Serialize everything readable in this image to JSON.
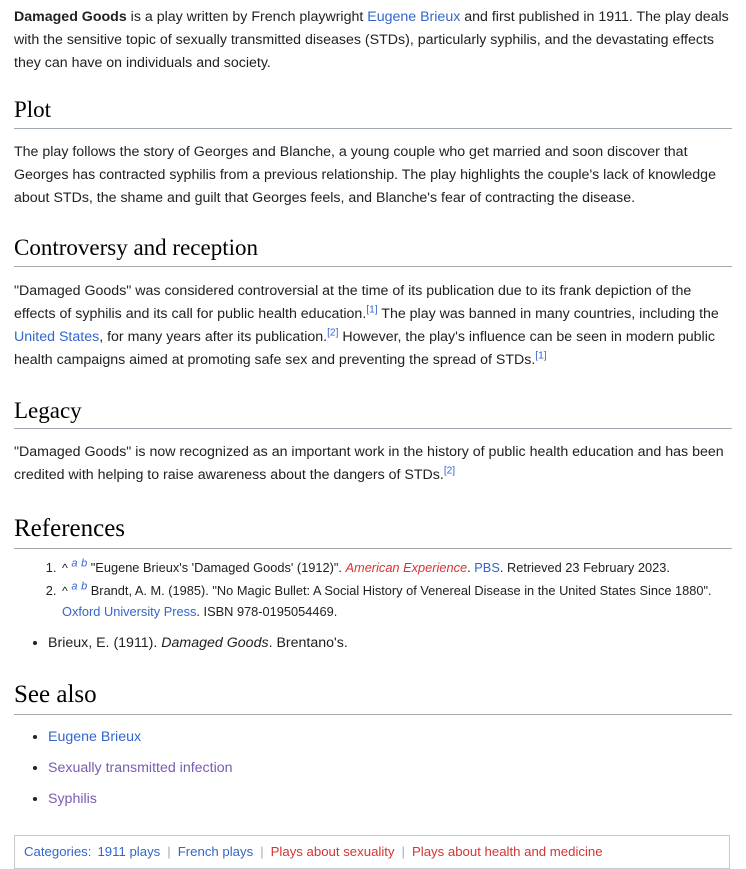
{
  "article": {
    "title": "Damaged Goods",
    "lead": {
      "title_bold": "Damaged Goods",
      "text_1": " is a play written by French playwright ",
      "link_brieux": "Eugene Brieux",
      "text_2": " and first published in 1911. The play deals with the sensitive topic of sexually transmitted diseases (STDs), particularly syphilis, and the devastating effects they can have on individuals and society."
    },
    "sections": {
      "plot": {
        "heading": "Plot",
        "body": "The play follows the story of Georges and Blanche, a young couple who get married and soon discover that Georges has contracted syphilis from a previous relationship. The play highlights the couple's lack of knowledge about STDs, the shame and guilt that Georges feels, and Blanche's fear of contracting the disease."
      },
      "controversy": {
        "heading": "Controversy and reception",
        "text_1": "\"Damaged Goods\" was considered controversial at the time of its publication due to its frank depiction of the effects of syphilis and its call for public health education.",
        "cite_1": "[1]",
        "text_2": " The play was banned in many countries, including the ",
        "link_us": "United States",
        "text_3": ", for many years after its publication.",
        "cite_2": "[2]",
        "text_4": " However, the play's influence can be seen in modern public health campaigns aimed at promoting safe sex and preventing the spread of STDs.",
        "cite_3": "[1]"
      },
      "legacy": {
        "heading": "Legacy",
        "text_1": "\"Damaged Goods\" is now recognized as an important work in the history of public health education and has been credited with helping to raise awareness about the dangers of STDs.",
        "cite_1": "[2]"
      },
      "references": {
        "heading": "References",
        "items": [
          {
            "caret": "^",
            "back_a": "a",
            "back_b": "b",
            "text_1": "\"Eugene Brieux's 'Damaged Goods' (1912)\". ",
            "work_italic_red": "American Experience",
            "text_2": ". ",
            "link_pbs": "PBS",
            "text_3": ". Retrieved 23 February 2023."
          },
          {
            "caret": "^",
            "back_a": "a",
            "back_b": "b",
            "text_1": "Brandt, A. M. (1985). \"No Magic Bullet: A Social History of Venereal Disease in the United States Since 1880\". ",
            "link_publisher": "Oxford University Press",
            "text_2": ". ISBN 978-0195054469."
          }
        ],
        "bibliography": [
          {
            "text_1": "Brieux, E. (1911). ",
            "title_italic": "Damaged Goods",
            "text_2": ". Brentano's."
          }
        ]
      },
      "see_also": {
        "heading": "See also",
        "items": [
          {
            "label": "Eugene Brieux",
            "state": "unvisited"
          },
          {
            "label": "Sexually transmitted infection",
            "state": "visited"
          },
          {
            "label": "Syphilis",
            "state": "visited"
          }
        ]
      }
    },
    "categories": {
      "label": "Categories:",
      "separator": "|",
      "items": [
        {
          "label": "1911 plays",
          "state": "blue"
        },
        {
          "label": "French plays",
          "state": "blue"
        },
        {
          "label": "Plays about sexuality",
          "state": "red"
        },
        {
          "label": "Plays about health and medicine",
          "state": "red"
        }
      ]
    }
  },
  "colors": {
    "link_blue": "#3366cc",
    "link_visited": "#795cb2",
    "link_red": "#d73333",
    "text": "#202122",
    "rule": "#a2a9b1",
    "box_border": "#c8ccd1"
  }
}
